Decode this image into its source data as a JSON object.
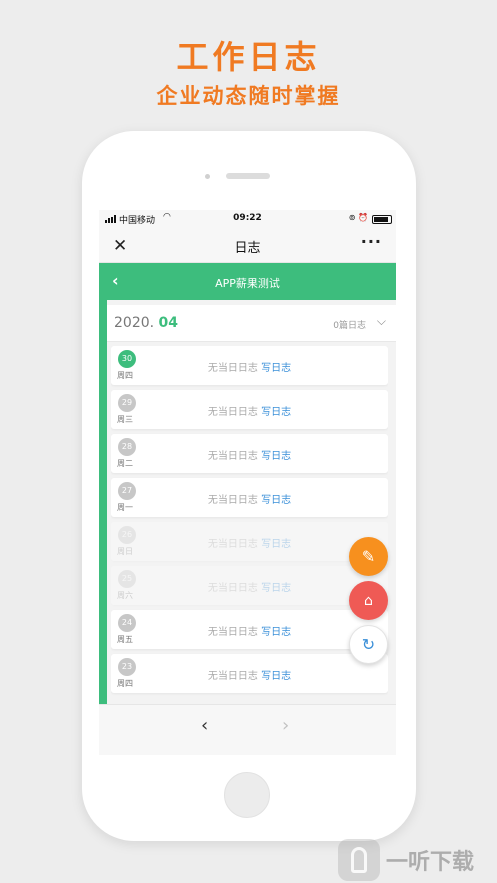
{
  "promo": {
    "title": "工作日志",
    "subtitle": "企业动态随时掌握"
  },
  "status_bar": {
    "carrier": "中国移动",
    "time": "09:22"
  },
  "nav_bar": {
    "title": "日志",
    "close_icon": "close-icon",
    "more_icon": "more-icon",
    "more_glyph": "···"
  },
  "app_header": {
    "title": "APP薪果测试"
  },
  "month_header": {
    "year": "2020.",
    "month": "04",
    "log_count": "0篇日志"
  },
  "days": [
    {
      "day": "30",
      "weekday": "周四",
      "empty_text": "无当日日志",
      "write_label": "写日志",
      "active": true
    },
    {
      "day": "29",
      "weekday": "周三",
      "empty_text": "无当日日志",
      "write_label": "写日志"
    },
    {
      "day": "28",
      "weekday": "周二",
      "empty_text": "无当日日志",
      "write_label": "写日志"
    },
    {
      "day": "27",
      "weekday": "周一",
      "empty_text": "无当日日志",
      "write_label": "写日志"
    },
    {
      "day": "26",
      "weekday": "周日",
      "empty_text": "无当日日志",
      "write_label": "写日志",
      "faded": true
    },
    {
      "day": "25",
      "weekday": "周六",
      "empty_text": "无当日日志",
      "write_label": "写日志",
      "faded": true
    },
    {
      "day": "24",
      "weekday": "周五",
      "empty_text": "无当日日志",
      "write_label": "写日志"
    },
    {
      "day": "23",
      "weekday": "周四",
      "empty_text": "无当日日志",
      "write_label": "写日志"
    }
  ],
  "fabs": [
    {
      "icon": "pencil-icon",
      "color": "#f7901e"
    },
    {
      "icon": "home-icon",
      "color": "#ef5a55"
    },
    {
      "icon": "refresh-icon",
      "color": "#3a8fd8"
    }
  ],
  "colors": {
    "brand_green": "#3dbd7d",
    "promo_orange": "#f07a22",
    "link_blue": "#3a8fd8"
  },
  "watermark": {
    "text": "一听下载"
  }
}
